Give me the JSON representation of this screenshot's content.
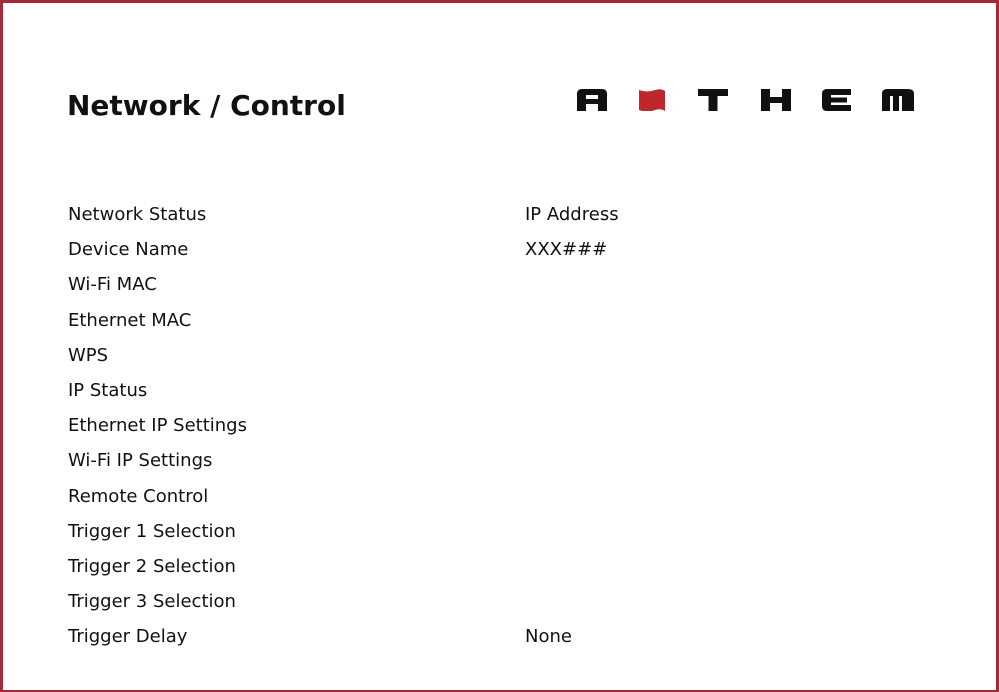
{
  "page": {
    "title": "Network / Control"
  },
  "logo": {
    "brand": "ANTHEM",
    "accent_color": "#c0272d",
    "mark_color": "#111111"
  },
  "frame": {
    "border_color": "#a52a35"
  },
  "settings": [
    {
      "label": "Network Status",
      "value": "IP Address"
    },
    {
      "label": "Device Name",
      "value": "XXX###"
    },
    {
      "label": "Wi-Fi MAC",
      "value": ""
    },
    {
      "label": "Ethernet MAC",
      "value": ""
    },
    {
      "label": "WPS",
      "value": ""
    },
    {
      "label": "IP Status",
      "value": ""
    },
    {
      "label": "Ethernet IP Settings",
      "value": ""
    },
    {
      "label": "Wi-Fi IP Settings",
      "value": ""
    },
    {
      "label": "Remote Control",
      "value": ""
    },
    {
      "label": "Trigger 1 Selection",
      "value": ""
    },
    {
      "label": "Trigger 2 Selection",
      "value": ""
    },
    {
      "label": "Trigger 3 Selection",
      "value": ""
    },
    {
      "label": "Trigger Delay",
      "value": "None"
    }
  ]
}
